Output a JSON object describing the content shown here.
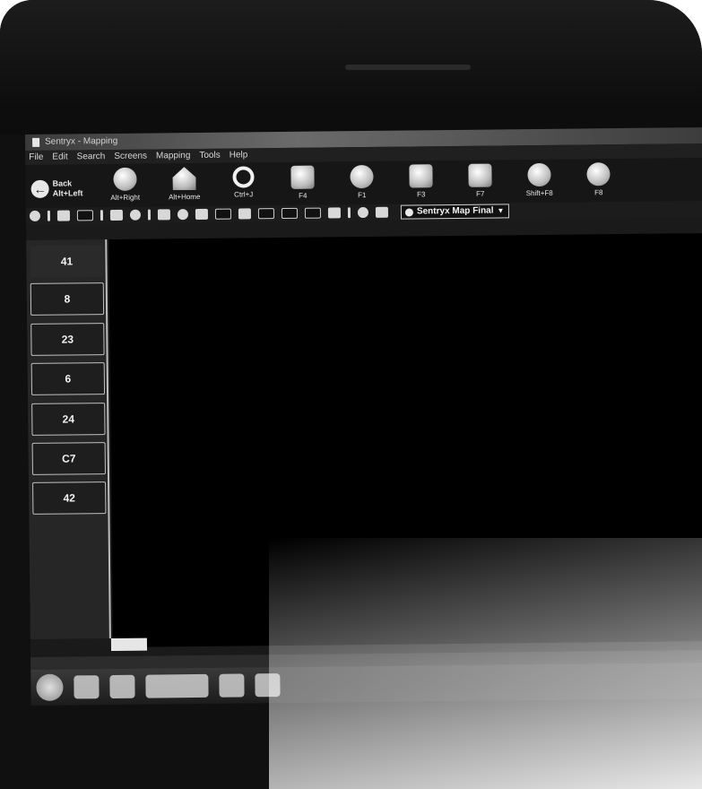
{
  "window": {
    "title": "Sentryx - Mapping"
  },
  "menu": {
    "items": [
      "File",
      "Edit",
      "Search",
      "Screens",
      "Mapping",
      "Tools",
      "Help"
    ]
  },
  "toolbar": {
    "back_label": "Back",
    "back_shortcut": "Alt+Left",
    "forward_shortcut": "Alt+Right",
    "home_shortcut": "Alt+Home",
    "search_shortcut": "Ctrl+J",
    "b5_shortcut": "F4",
    "b6_shortcut": "F1",
    "print_shortcut": "F3",
    "b8_shortcut": "F7",
    "b9_shortcut": "Shift+F8",
    "b10_shortcut": "F8"
  },
  "layer_select": {
    "value": "Sentryx Map Final"
  },
  "zones": [
    "41",
    "8",
    "23",
    "6",
    "24",
    "C7",
    "42"
  ],
  "colors": {
    "canvas": "#000000",
    "panel": "#262626",
    "accent": "#e6e6e6"
  }
}
